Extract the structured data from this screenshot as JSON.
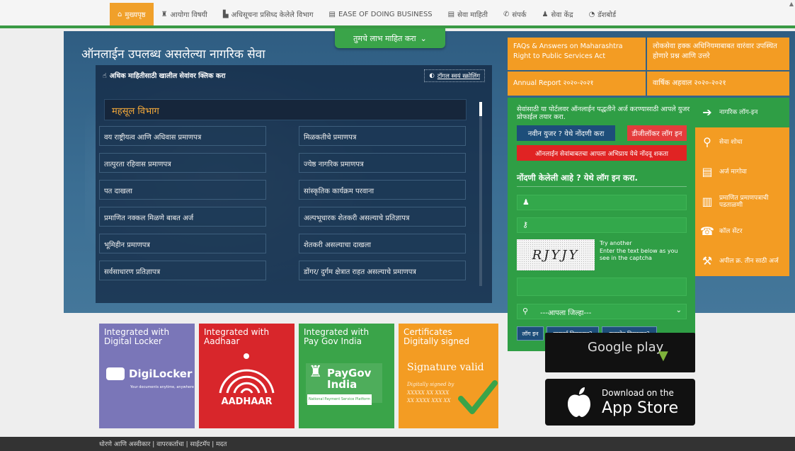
{
  "nav": {
    "items": [
      {
        "label": "मुख्यपृष्ठ",
        "icon": "home-icon"
      },
      {
        "label": "आयोगा विषयी",
        "icon": "emblem-icon"
      },
      {
        "label": "अधिसूचना प्रसिध्द केलेले विभाग",
        "icon": "building-icon"
      },
      {
        "label": "EASE OF DOING BUSINESS",
        "icon": "briefcase-icon"
      },
      {
        "label": "सेवा माहिती",
        "icon": "briefcase-icon"
      },
      {
        "label": "संपर्क",
        "icon": "phone-icon"
      },
      {
        "label": "सेवा केंद्र",
        "icon": "people-icon"
      },
      {
        "label": "डॅशबोर्ड",
        "icon": "gauge-icon"
      }
    ]
  },
  "hero": {
    "know_more": "तुमचे लाभ माहित करा",
    "title": "ऑनलाईन उपलब्ध असलेल्या नागरिक सेवा",
    "panel_heading": "अधिक माहितीसाठी खालील सेवांवर क्लिक करा",
    "toggle_label": "टॉगल स्वयं स्क्रोलिंग",
    "department": "महसूल विभाग",
    "services": [
      "वय राष्ट्रीयत्व आणि अधिवास प्रमाणपत्र",
      "मिळकतीचे प्रमाणपत्र",
      "तात्पुरता रहिवास प्रमाणपत्र",
      "ज्येष्ठ नागरिक प्रमाणपत्र",
      "पत दाखला",
      "सांस्कृतिक कार्यक्रम परवाना",
      "प्रमाणित नक्कल मिळणे बाबत अर्ज",
      "अल्पभूधारक शेतकरी असल्याचे प्रतिज्ञापत्र",
      "भूमिहीन प्रमाणपत्र",
      "शेतकरी असल्याचा दाखला",
      "सर्वसाधारण प्रतिज्ञापत्र",
      "डोंगर/ दुर्गम क्षेत्रात राहत असल्याचे प्रमाणपत्र"
    ]
  },
  "info_links": {
    "faq": "FAQs & Answers on Maharashtra Right to Public Services Act",
    "faq_mr": "लोकसेवा हक्क अधिनियमाबाबत वारंवार उपस्थित होणारे प्रश्न आणि उत्तरे",
    "annual_report": "Annual Report २०२०-२०२१",
    "annual_report_mr": "वार्षिक अहवाल २०२०-२०२१"
  },
  "login": {
    "intro": "सेवांसाठी या पोर्टलवर ऑनलाईन पद्धतीने अर्ज करण्यासाठी आपले युजर प्रोफाईल तयार करा.",
    "new_user": "नवीन युजर ? येथे नोंदणी करा",
    "digilocker_login": "डीजीलॉकर लॉग इन",
    "feedback": "ऑनलाईन सेवांबाबतचा आपला अभिप्राय येथे नोंदवू शकता",
    "title": "नोंदणी केलेली आहे ? येथे लॉग इन करा.",
    "username_value": "",
    "password_value": "",
    "captcha_text": "RJYJY",
    "try_another": "Try another",
    "captcha_hint": "Enter the text below as you see in the captcha",
    "captcha_value": "",
    "district_placeholder": "---आपला जिल्हा---",
    "login_btn": "लॉग इन",
    "forgot_password": "पासवर्ड विसरलात?",
    "forgot_username": "युजरनेम विसरलात?"
  },
  "quick_links": [
    {
      "label": "नागरिक लॉग-इन",
      "icon": "signin-icon"
    },
    {
      "label": "सेवा शोधा",
      "icon": "search-icon"
    },
    {
      "label": "अर्ज मागोवा",
      "icon": "document-icon"
    },
    {
      "label": "प्रमाणित प्रमाणपत्राची पडताळणी",
      "icon": "barcode-icon"
    },
    {
      "label": "कॉल सेंटर",
      "icon": "phone-icon"
    },
    {
      "label": "अपील क्र. तीन साठी अर्ज",
      "icon": "gavel-icon"
    }
  ],
  "tiles": [
    {
      "line1": "Integrated with",
      "line2": "Digital Locker",
      "brand": "DigiLocker",
      "tagline": "Your documents anytime, anywhere",
      "color": "#7a76b8"
    },
    {
      "line1": "Integrated with",
      "line2": "Aadhaar",
      "brand": "AADHAAR",
      "color": "#d8262b"
    },
    {
      "line1": "Integrated with",
      "line2": "Pay Gov India",
      "brand": "PayGov India",
      "subtitle": "National Payment Service Platform",
      "color": "#3aa449"
    },
    {
      "line1": "Certificates",
      "line2": "Digitally signed",
      "sig_title": "Signature valid",
      "sig_by": "Digitally signed by",
      "sig_l1": "XXXXX XX XXXX",
      "sig_l2": "XX XXXX XXX XX",
      "color": "#f39c23"
    }
  ],
  "stores": {
    "google": "Google play",
    "apple_small": "Download on the",
    "apple_big": "App Store"
  },
  "footer": {
    "text": "धोरणे आणि अस्वीकार | वापरकर्ताचा | साईटमॅप | मदत"
  },
  "colors": {
    "orange": "#f39c23",
    "green": "#2f9e45",
    "navy": "#1d4e7a",
    "red": "#e02323"
  }
}
